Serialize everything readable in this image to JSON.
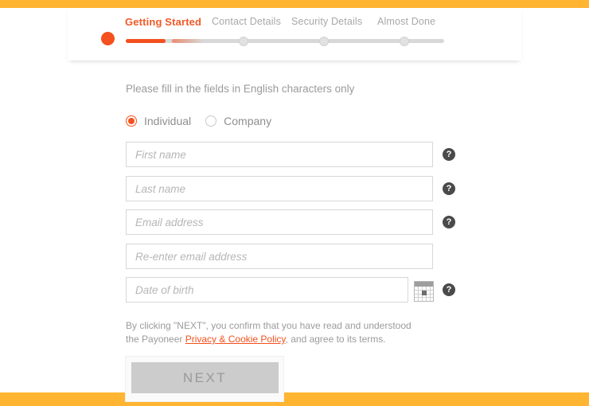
{
  "theme": {
    "brand_bar_color": "#ffb432",
    "accent_color": "#f4511e",
    "active_step_color": "#f05a28",
    "muted_text_color": "#9b9b9b",
    "field_border_color": "#d7d7d7",
    "disabled_button_color": "#cccccc"
  },
  "stepper": {
    "steps": [
      {
        "label": "Getting Started",
        "state": "active"
      },
      {
        "label": "Contact Details",
        "state": "upcoming"
      },
      {
        "label": "Security Details",
        "state": "upcoming"
      },
      {
        "label": "Almost Done",
        "state": "upcoming"
      }
    ]
  },
  "form": {
    "intro": "Please fill in the fields in English characters only",
    "account_type": {
      "selected": "Individual",
      "options": [
        {
          "label": "Individual",
          "checked": true
        },
        {
          "label": "Company",
          "checked": false
        }
      ]
    },
    "fields": [
      {
        "name": "first-name",
        "placeholder": "First name",
        "value": "",
        "help": true,
        "calendar": false
      },
      {
        "name": "last-name",
        "placeholder": "Last name",
        "value": "",
        "help": true,
        "calendar": false
      },
      {
        "name": "email",
        "placeholder": "Email address",
        "value": "",
        "help": true,
        "calendar": false
      },
      {
        "name": "email-confirm",
        "placeholder": "Re-enter email address",
        "value": "",
        "help": false,
        "calendar": false
      },
      {
        "name": "date-of-birth",
        "placeholder": "Date of birth",
        "value": "",
        "help": true,
        "calendar": true
      }
    ],
    "help_icon_glyph": "?",
    "terms": {
      "part1": "By clicking \"NEXT\", you confirm that you have read and understood the Payoneer ",
      "link": "Privacy & Cookie Policy",
      "part2": ", and agree to its terms."
    },
    "submit_label": "NEXT"
  }
}
